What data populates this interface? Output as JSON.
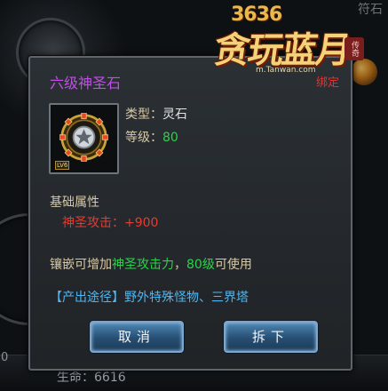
{
  "background": {
    "top_right_text": "符石",
    "left_number": "0",
    "life_label": "生命：",
    "life_value": "6616"
  },
  "watermark": {
    "brand_text": "贪玩蓝月",
    "number_text": "3636",
    "url": "m.Tanwan.com",
    "stamp": "传奇"
  },
  "tooltip": {
    "item_name": "六级神圣石",
    "bound_status": "绑定",
    "type_label": "类型：",
    "type_value": "灵石",
    "level_label": "等级：",
    "level_value": "80",
    "icon_level_tag": "LV6",
    "section_title": "基础属性",
    "attr_label": "神圣攻击：",
    "attr_value": "+900",
    "note_prefix": "镶嵌可增加",
    "note_highlight1": "神圣攻击力",
    "note_middle": "，",
    "note_highlight2": "80级",
    "note_suffix": "可使用",
    "source_text": "【产出途径】野外特殊怪物、三界塔"
  },
  "buttons": {
    "cancel": "取消",
    "remove": "拆下"
  },
  "colors": {
    "item_name": "#c04ee6",
    "bound": "#e2342f",
    "highlight_green": "#2ad34a",
    "attr_red": "#e53c2f",
    "source_blue": "#4fb6f0"
  },
  "icons": [
    "gem-icon",
    "medal-icon"
  ]
}
